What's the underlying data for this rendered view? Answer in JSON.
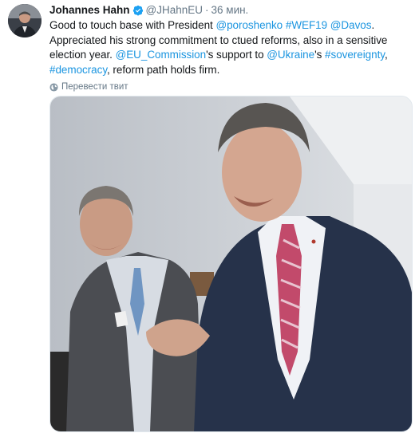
{
  "tweet": {
    "author_name": "Johannes Hahn",
    "handle": "@JHahnEU",
    "separator": "·",
    "time": "36 мин.",
    "text_parts": [
      {
        "text": "Good to touch base with President ",
        "link": false
      },
      {
        "text": "@poroshenko",
        "link": true
      },
      {
        "text": " ",
        "link": false
      },
      {
        "text": "#WEF19",
        "link": true
      },
      {
        "text": " ",
        "link": false
      },
      {
        "text": "@Davos",
        "link": true
      },
      {
        "text": ". Appreciated his strong commitment to ctued reforms, also in a sensitive election year. ",
        "link": false
      },
      {
        "text": "@EU_Commission",
        "link": true
      },
      {
        "text": "'s support to ",
        "link": false
      },
      {
        "text": "@Ukraine",
        "link": true
      },
      {
        "text": "'s ",
        "link": false
      },
      {
        "text": "#sovereignty",
        "link": true
      },
      {
        "text": ", ",
        "link": false
      },
      {
        "text": "#democracy",
        "link": true
      },
      {
        "text": ", reform path holds firm.",
        "link": false
      }
    ],
    "translate_label": "Перевести твит",
    "icons": {
      "verified": "verified-badge-icon",
      "translate": "globe-icon"
    },
    "colors": {
      "link": "#1b95e0",
      "muted": "#657786",
      "verified": "#1da1f2"
    }
  }
}
